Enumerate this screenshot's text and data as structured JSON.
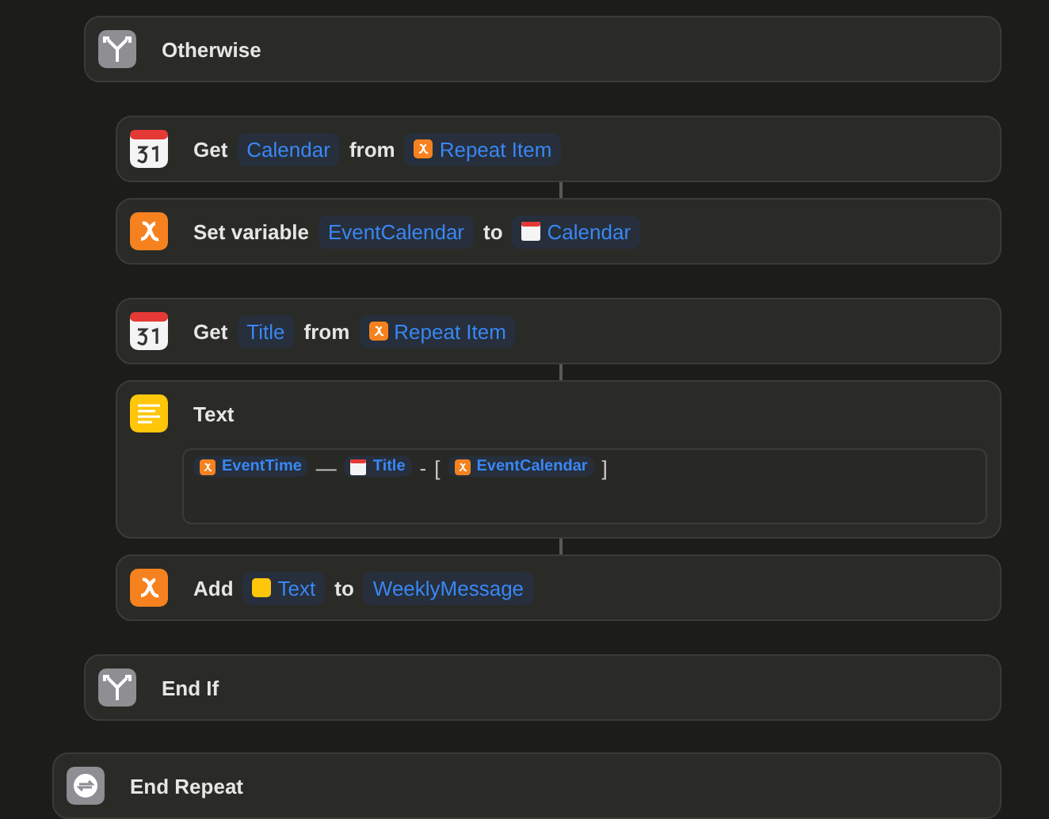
{
  "repeat_body": [
    {
      "kind": "branch",
      "parts": [
        {
          "kind": "label",
          "text": "Otherwise"
        }
      ],
      "groups": [
        [
          {
            "kind": "calendar",
            "parts": [
              {
                "kind": "label",
                "text": "Get"
              },
              {
                "kind": "token",
                "text": "Calendar"
              },
              {
                "kind": "label",
                "text": "from"
              },
              {
                "kind": "variable",
                "text": "Repeat Item"
              }
            ]
          },
          {
            "kind": "variable",
            "parts": [
              {
                "kind": "label",
                "text": "Set variable"
              },
              {
                "kind": "token",
                "text": "EventCalendar"
              },
              {
                "kind": "label",
                "text": "to"
              },
              {
                "kind": "calendar",
                "text": "Calendar"
              }
            ]
          }
        ],
        [
          {
            "kind": "calendar",
            "parts": [
              {
                "kind": "label",
                "text": "Get"
              },
              {
                "kind": "token",
                "text": "Title"
              },
              {
                "kind": "label",
                "text": "from"
              },
              {
                "kind": "variable",
                "text": "Repeat Item"
              }
            ]
          },
          {
            "kind": "text",
            "parts": [
              {
                "kind": "label",
                "text": "Text"
              }
            ],
            "body": [
              {
                "kind": "variable",
                "text": "EventTime"
              },
              {
                "kind": "label",
                "text": "—"
              },
              {
                "kind": "calendar",
                "text": "Title"
              },
              {
                "kind": "label",
                "text": "-"
              },
              {
                "kind": "label",
                "text": "["
              },
              {
                "kind": "variable",
                "text": "EventCalendar"
              },
              {
                "kind": "label",
                "text": "]"
              }
            ]
          },
          {
            "kind": "variable",
            "parts": [
              {
                "kind": "label",
                "text": "Add"
              },
              {
                "kind": "text",
                "text": "Text"
              },
              {
                "kind": "label",
                "text": "to"
              },
              {
                "kind": "token",
                "text": "WeeklyMessage"
              }
            ]
          }
        ]
      ]
    },
    {
      "kind": "branch",
      "parts": [
        {
          "kind": "label",
          "text": "End If"
        }
      ]
    }
  ],
  "end_repeat": {
    "kind": "repeat",
    "parts": [
      {
        "kind": "label",
        "text": "End Repeat"
      }
    ]
  }
}
